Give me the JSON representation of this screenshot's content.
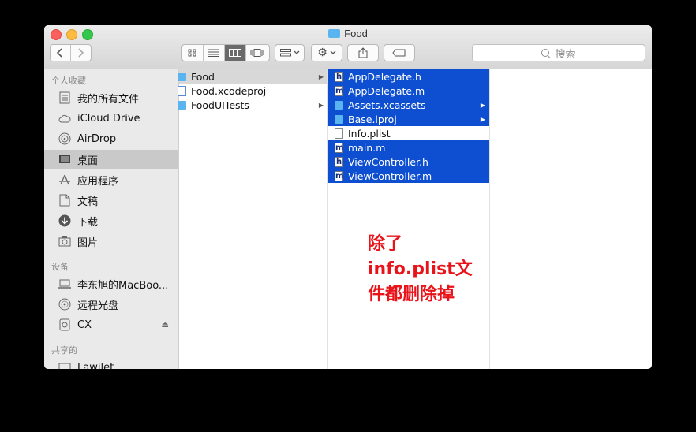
{
  "window": {
    "title": "Food"
  },
  "toolbar": {
    "search_placeholder": "搜索"
  },
  "sidebar": {
    "favorites_header": "个人收藏",
    "favorites": [
      {
        "label": "我的所有文件",
        "icon": "all-files-icon"
      },
      {
        "label": "iCloud Drive",
        "icon": "cloud-icon"
      },
      {
        "label": "AirDrop",
        "icon": "airdrop-icon"
      },
      {
        "label": "桌面",
        "icon": "desktop-icon"
      },
      {
        "label": "应用程序",
        "icon": "applications-icon"
      },
      {
        "label": "文稿",
        "icon": "documents-icon"
      },
      {
        "label": "下载",
        "icon": "download-icon"
      },
      {
        "label": "图片",
        "icon": "camera-icon"
      }
    ],
    "devices_header": "设备",
    "devices": [
      {
        "label": "李东旭的MacBoo...",
        "icon": "laptop-icon"
      },
      {
        "label": "远程光盘",
        "icon": "disc-icon"
      },
      {
        "label": "CX",
        "icon": "drive-icon"
      }
    ],
    "shared_header": "共享的",
    "shared": [
      {
        "label": "Lawilet",
        "icon": "computer-icon"
      }
    ]
  },
  "column1": [
    {
      "name": "Food",
      "type": "folder",
      "has_children": true
    },
    {
      "name": "Food.xcodeproj",
      "type": "xcodeproj",
      "has_children": false
    },
    {
      "name": "FoodUITests",
      "type": "folder",
      "has_children": true
    }
  ],
  "column2": [
    {
      "name": "AppDelegate.h",
      "type": "h",
      "selected": true,
      "has_children": false
    },
    {
      "name": "AppDelegate.m",
      "type": "m",
      "selected": true,
      "has_children": false
    },
    {
      "name": "Assets.xcassets",
      "type": "folder",
      "selected": true,
      "has_children": true
    },
    {
      "name": "Base.lproj",
      "type": "folder",
      "selected": true,
      "has_children": true
    },
    {
      "name": "Info.plist",
      "type": "plist",
      "selected": false,
      "has_children": false
    },
    {
      "name": "main.m",
      "type": "m",
      "selected": true,
      "has_children": false
    },
    {
      "name": "ViewController.h",
      "type": "h",
      "selected": true,
      "has_children": false
    },
    {
      "name": "ViewController.m",
      "type": "m",
      "selected": true,
      "has_children": false
    }
  ],
  "annotation": {
    "lines": [
      "除了",
      "info.plist文",
      "件都删除掉"
    ],
    "color": "#e8141a"
  },
  "colors": {
    "selection": "#0d4fd0",
    "folder": "#5ab4f0"
  }
}
